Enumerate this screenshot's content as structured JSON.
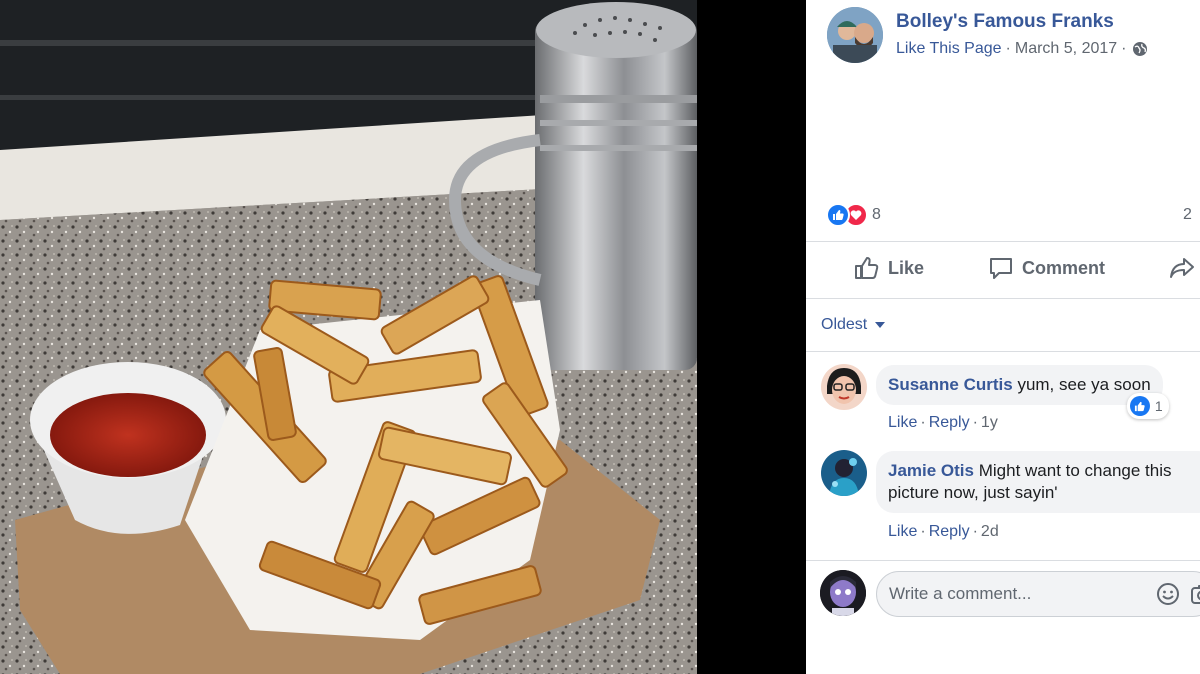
{
  "post": {
    "page_name": "Bolley's Famous Franks",
    "like_page": "Like This Page",
    "date": "March 5, 2017",
    "privacy_icon": "globe-icon"
  },
  "reactions": {
    "count": "8",
    "types": [
      "like-icon",
      "love-icon"
    ],
    "comment_count": "2"
  },
  "actions": {
    "like": "Like",
    "comment": "Comment",
    "share_icon": "share-icon"
  },
  "sort": {
    "label": "Oldest"
  },
  "comments": [
    {
      "author": "Susanne Curtis",
      "text": "yum, see ya soon",
      "like": "Like",
      "reply": "Reply",
      "time": "1y",
      "reaction_count": "1"
    },
    {
      "author": "Jamie Otis",
      "text_line1": "Might want to change this",
      "text_line2": "picture now, just sayin'",
      "like": "Like",
      "reply": "Reply",
      "time": "2d"
    }
  ],
  "compose": {
    "placeholder": "Write a comment...",
    "icons": [
      "emoji-icon",
      "camera-icon"
    ]
  },
  "colors": {
    "link": "#385898",
    "meta": "#606770",
    "like_blue": "#1877f2",
    "love_red": "#f0284a"
  }
}
